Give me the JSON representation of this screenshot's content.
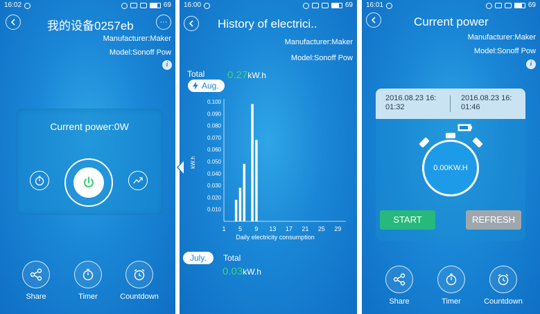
{
  "screen1": {
    "status": {
      "time": "16:02",
      "battery": "69"
    },
    "title": "我的设备0257eb",
    "manufacturer": "Manufacturer:Maker",
    "model": "Model:Sonoff Pow",
    "card": {
      "label": "Current power:0W"
    },
    "bottom": [
      {
        "label": "Share",
        "icon": "share-icon"
      },
      {
        "label": "Timer",
        "icon": "timer-icon"
      },
      {
        "label": "Countdown",
        "icon": "alarm-clock-icon"
      }
    ]
  },
  "screen2": {
    "status": {
      "time": "16:00",
      "battery": "69"
    },
    "title": "History of electrici..",
    "manufacturer": "Manufacturer:Maker",
    "model": "Model:Sonoff Pow",
    "total_label": "Total",
    "total_value": "0.27",
    "unit": "kW.h",
    "month": "Aug.",
    "prev_month": "July.",
    "prev_total_label": "Total",
    "prev_total_value": "0.03",
    "prev_unit": "kW.h"
  },
  "chart_data": {
    "type": "bar",
    "xlabel": "Daily electricity consumption",
    "ylabel": "kW.h",
    "ylim": [
      0,
      0.1
    ],
    "yticks": [
      "0.010",
      "0.020",
      "0.030",
      "0.040",
      "0.050",
      "0.060",
      "0.070",
      "0.080",
      "0.090",
      "0.100"
    ],
    "xticks": [
      "1",
      "5",
      "9",
      "13",
      "17",
      "21",
      "25",
      "29"
    ],
    "xlim": [
      1,
      31
    ],
    "bar_color": "#ffffff",
    "x": [
      4,
      5,
      6,
      8,
      9
    ],
    "values": [
      0.018,
      0.028,
      0.048,
      0.098,
      0.068
    ]
  },
  "screen3": {
    "status": {
      "time": "16:01",
      "battery": "69"
    },
    "title": "Current power",
    "manufacturer": "Manufacturer:Maker",
    "model": "Model:Sonoff Pow",
    "start_time_line1": "2016.08.23 16:",
    "start_time_line2": "01:32",
    "end_time_line1": "2016.08.23 16:",
    "end_time_line2": "01:46",
    "reading": "0.00KW.H",
    "start_label": "START",
    "refresh_label": "REFRESH",
    "bottom": [
      {
        "label": "Share",
        "icon": "share-icon"
      },
      {
        "label": "Timer",
        "icon": "timer-icon"
      },
      {
        "label": "Countdown",
        "icon": "alarm-clock-icon"
      }
    ]
  },
  "colors": {
    "accent_green": "#3dd17a",
    "start_green": "#27b87d",
    "refresh_grey": "#9ea7ad",
    "bg_blue": "#1a86d6"
  }
}
